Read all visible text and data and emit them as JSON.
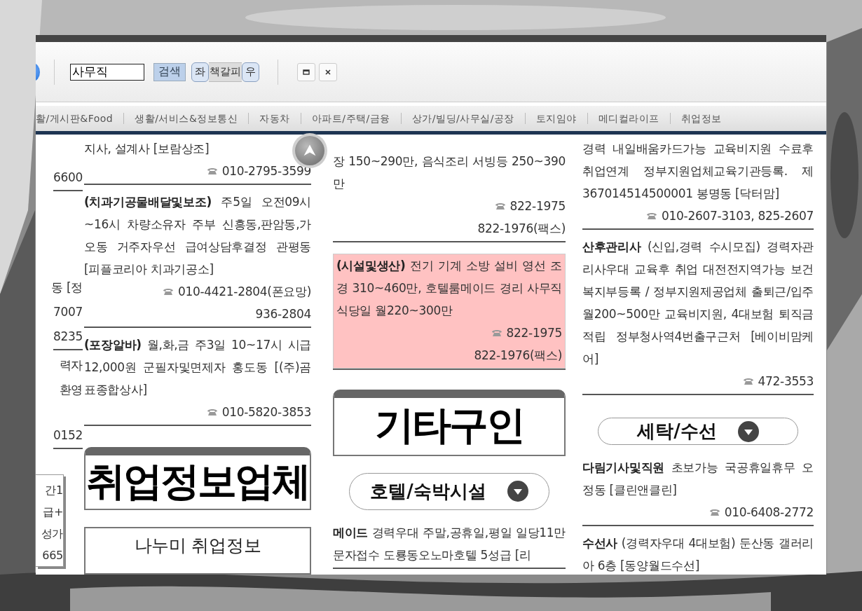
{
  "toolbar": {
    "search": {
      "value": "사무직"
    },
    "search_button": "검색",
    "segments": [
      {
        "label": "좌",
        "kind": "side"
      },
      {
        "label": "책갈피",
        "kind": "middle"
      },
      {
        "label": "우",
        "kind": "side"
      }
    ]
  },
  "nav": [
    "활/게시판&Food",
    "생활/서비스&정보통신",
    "자동차",
    "아파트/주택/금융",
    "상가/빌딩/사무실/공장",
    "토지임야",
    "메디컬라이프",
    "취업정보"
  ],
  "left_strip": {
    "fragments": [
      {
        "text": "6600",
        "ruled": true
      },
      {
        "text": "동 [정",
        "ruled": false
      },
      {
        "text": "7007",
        "ruled": false
      },
      {
        "text": "8235",
        "ruled": true
      },
      {
        "text": "력자",
        "ruled": false
      },
      {
        "text": "환영",
        "ruled": false
      },
      {
        "text": "0152",
        "ruled": true
      }
    ],
    "popup": [
      "간1",
      "급+",
      "성가",
      "665"
    ]
  },
  "columns": [
    [
      {
        "kind": "ad",
        "highlighted": false,
        "text": "지사, 설계사 [보람상조]",
        "phones": [
          {
            "text": "010-2795-3599",
            "icon": true
          }
        ]
      },
      {
        "kind": "ad",
        "highlighted": false,
        "text": "**(치과기공물배달및보조)** 주5일 오전09시 ~16시 차량소유자 주부 신흥동,판암동,가오동 거주자우선 급여상담후결정 관평동 [피플코리아 치과기공소]",
        "phones": [
          {
            "text": "010-4421-2804(폰요망)",
            "icon": true
          },
          {
            "text": "936-2804",
            "icon": false
          }
        ]
      },
      {
        "kind": "ad",
        "highlighted": false,
        "text": "**(포장알바)** 월,화,금 주3일 10~17시 시급 12,000원 군필자및면제자 홍도동 [(주)곰표종합상사]",
        "phones": [
          {
            "text": "010-5820-3853",
            "icon": true
          }
        ]
      },
      {
        "kind": "box_header",
        "text": "취업정보업체"
      },
      {
        "kind": "subbox",
        "text": "나누미 취업정보"
      }
    ],
    [
      {
        "kind": "ad",
        "highlighted": false,
        "text": "장 150~290만, 음식조리 서빙등 250~390만",
        "phones": [
          {
            "text": "822-1975",
            "icon": true
          },
          {
            "text": "822-1976(팩스)",
            "icon": false
          }
        ]
      },
      {
        "kind": "ad",
        "highlighted": true,
        "text": "**(시설및생산)** 전기 기계 소방 설비 영선 조경 310~460만, 호텔룸메이드 경리 사무직 식당일 월220~300만",
        "phones": [
          {
            "text": "822-1975",
            "icon": true
          },
          {
            "text": "822-1976(팩스)",
            "icon": false
          }
        ]
      },
      {
        "kind": "box_header",
        "text": "기타구인"
      },
      {
        "kind": "pill_header",
        "text": "호텔/숙박시설"
      },
      {
        "kind": "ad",
        "highlighted": false,
        "text": "**메이드** 경력우대 주말,공휴일,평일 일당11만 문자접수 도룡동오노마호텔 5성급 [리"
      }
    ],
    [
      {
        "kind": "ad",
        "highlighted": false,
        "text": "경력 내일배움카드가능 교육비지원 수료후 취업연계 정부지원업체교육기관등록. 제 367014514500001 봉명동 [닥터맘]",
        "phones": [
          {
            "text": "010-2607-3103, 825-2607",
            "icon": true
          }
        ]
      },
      {
        "kind": "ad",
        "highlighted": false,
        "text": "**산후관리사** (신입,경력 수시모집) 경력자관리사우대 교육후 취업 대전전지역가능 보건복지부등록 / 정부지원제공업체 출퇴근/입주 월200~500만 교육비지원, 4대보험 퇴직금적립 정부청사역4번출구근처 [베이비맘케어]",
        "phones": [
          {
            "text": "472-3553",
            "icon": true
          }
        ]
      },
      {
        "kind": "pill_header",
        "text": "세탁/수선"
      },
      {
        "kind": "ad",
        "highlighted": false,
        "text": "**다림기사및직원** 초보가능 국공휴일휴무 오정동 [클린앤클린]",
        "phones": [
          {
            "text": "010-6408-2772",
            "icon": true
          }
        ]
      },
      {
        "kind": "ad",
        "highlighted": false,
        "text": "**수선사** (경력자우대 4대보험) 둔산동 갤러리아 6층 [동양월드수선]"
      }
    ]
  ]
}
